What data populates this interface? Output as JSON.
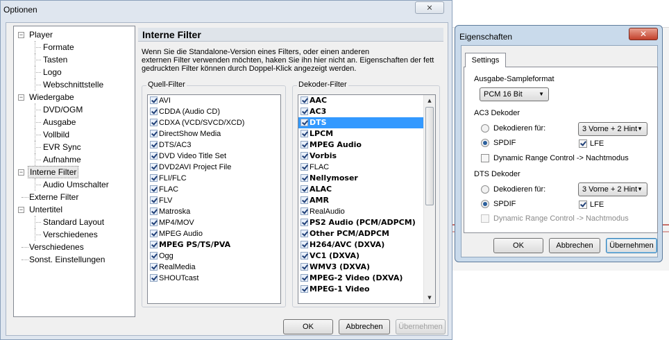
{
  "window": {
    "title": "Optionen",
    "close_icon": "close-icon"
  },
  "tree": {
    "items": [
      {
        "label": "Player"
      },
      {
        "label": "Formate"
      },
      {
        "label": "Tasten"
      },
      {
        "label": "Logo"
      },
      {
        "label": "Webschnittstelle"
      },
      {
        "label": "Wiedergabe"
      },
      {
        "label": "DVD/OGM"
      },
      {
        "label": "Ausgabe"
      },
      {
        "label": "Vollbild"
      },
      {
        "label": "EVR Sync"
      },
      {
        "label": "Aufnahme"
      },
      {
        "label": "Interne Filter"
      },
      {
        "label": "Audio Umschalter"
      },
      {
        "label": "Externe Filter"
      },
      {
        "label": "Untertitel"
      },
      {
        "label": "Standard Layout"
      },
      {
        "label": "Verschiedenes"
      },
      {
        "label": "Verschiedenes"
      },
      {
        "label": "Sonst. Einstellungen"
      }
    ]
  },
  "panel": {
    "header": "Interne Filter",
    "description": [
      "Wenn Sie die Standalone-Version eines Filters, oder einen anderen",
      "externen Filter verwenden möchten, haken Sie ihn hier nicht an. Eigenschaften der fett",
      "gedruckten Filter können durch Doppel-Klick angezeigt werden."
    ],
    "source_group": "Quell-Filter",
    "decoder_group": "Dekoder-Filter",
    "source_filters": [
      "AVI",
      "CDDA (Audio CD)",
      "CDXA (VCD/SVCD/XCD)",
      "DirectShow Media",
      "DTS/AC3",
      "DVD Video Title Set",
      "DVD2AVI Project File",
      "FLI/FLC",
      "FLAC",
      "FLV",
      "Matroska",
      "MP4/MOV",
      "MPEG Audio",
      "MPEG PS/TS/PVA",
      "Ogg",
      "RealMedia",
      "SHOUTcast"
    ],
    "decoder_filters": [
      "AAC",
      "AC3",
      "DTS",
      "LPCM",
      "MPEG Audio",
      "Vorbis",
      "FLAC",
      "Nellymoser",
      "ALAC",
      "AMR",
      "RealAudio",
      "PS2 Audio (PCM/ADPCM)",
      "Other PCM/ADPCM",
      "H264/AVC (DXVA)",
      "VC1 (DXVA)",
      "WMV3 (DXVA)",
      "MPEG-2 Video (DXVA)",
      "MPEG-1 Video"
    ]
  },
  "buttons": {
    "ok": "OK",
    "cancel": "Abbrechen",
    "apply": "Übernehmen"
  },
  "props": {
    "title": "Eigenschaften",
    "tab": "Settings",
    "sample_format_label": "Ausgabe-Sampleformat",
    "sample_format_value": "PCM 16 Bit",
    "ac3_label": "AC3 Dekoder",
    "decode_for": "Dekodieren für:",
    "speaker_value": "3 Vorne + 2 Hint",
    "spdif": "SPDIF",
    "lfe": "LFE",
    "drc": "Dynamic Range Control -> Nachtmodus",
    "dts_label": "DTS Dekoder",
    "ok": "OK",
    "cancel": "Abbrechen",
    "apply": "Übernehmen"
  }
}
